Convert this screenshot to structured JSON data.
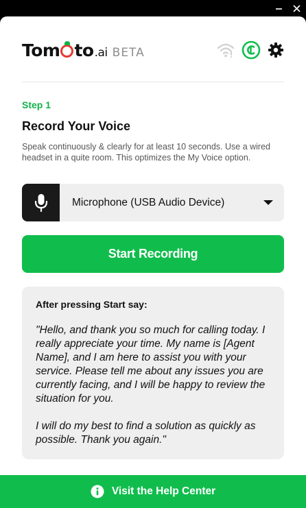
{
  "window": {
    "minimize_icon": "minimize-icon",
    "close_icon": "close-icon"
  },
  "header": {
    "logo_prefix": "Tom",
    "logo_suffix": "to",
    "logo_ai": ".ai",
    "beta_label": "BETA",
    "icons": [
      "wifi-icon",
      "agent-status-icon",
      "gear-icon"
    ]
  },
  "step": {
    "label": "Step 1",
    "title": "Record Your Voice",
    "description": "Speak continuously & clearly for at least 10 seconds. Use a wired headset in a quite room. This optimizes the My Voice option."
  },
  "microphone": {
    "icon": "microphone-icon",
    "selected": "Microphone (USB Audio Device)"
  },
  "start_button": {
    "label": "Start Recording"
  },
  "script": {
    "heading": "After pressing Start say:",
    "paragraph1": "\"Hello, and thank you so much for calling today. I really appreciate your time. My name is [Agent Name], and I am here to assist you with your service. Please tell me about any issues you are currently facing, and I will be happy to review the situation for you.",
    "paragraph2": "I will do my best to find a solution as quickly as possible. Thank you again.\""
  },
  "help": {
    "icon": "info-icon",
    "label": "Visit the Help Center"
  },
  "colors": {
    "accent": "#10bd4c",
    "tomato": "#e63a2e"
  }
}
